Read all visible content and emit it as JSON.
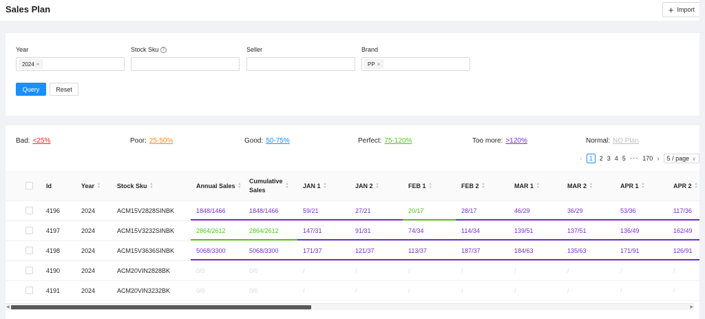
{
  "header": {
    "title": "Sales Plan",
    "import_label": "Import"
  },
  "filters": {
    "year": {
      "label": "Year",
      "tags": [
        "2024"
      ]
    },
    "stock_sku": {
      "label": "Stock Sku",
      "value": ""
    },
    "seller": {
      "label": "Seller",
      "value": ""
    },
    "brand": {
      "label": "Brand",
      "tags": [
        "PP"
      ]
    },
    "query_label": "Query",
    "reset_label": "Reset"
  },
  "legend": [
    {
      "label": "Bad:",
      "value": "<25%",
      "color": "#f5222d"
    },
    {
      "label": "Poor:",
      "value": "25-50%",
      "color": "#fa8c16"
    },
    {
      "label": "Good:",
      "value": "50-75%",
      "color": "#1890ff"
    },
    {
      "label": "Perfect:",
      "value": "75-120%",
      "color": "#52c41a"
    },
    {
      "label": "Too more:",
      "value": ">120%",
      "color": "#722ed1"
    },
    {
      "label": "Normal:",
      "value": "NO Plan",
      "color": "#bfbfbf"
    }
  ],
  "pagination": {
    "pages": [
      "1",
      "2",
      "3",
      "4",
      "5"
    ],
    "current": "1",
    "ellipsis": "•••",
    "last": "170",
    "page_size": "5 / page"
  },
  "table": {
    "columns": [
      "Id",
      "Year",
      "Stock Sku",
      "Annual Sales",
      "Cumulative Sales",
      "JAN 1",
      "JAN 2",
      "FEB 1",
      "FEB 2",
      "MAR 1",
      "MAR 2",
      "APR 1",
      "APR 2"
    ],
    "rows": [
      {
        "id": "4196",
        "year": "2024",
        "sku": "ACM15V2828SINBK",
        "cells": [
          "1848/1466",
          "1848/1466",
          "59/21",
          "27/21",
          "20/17",
          "28/17",
          "46/29",
          "36/29",
          "53/36",
          "117/36"
        ]
      },
      {
        "id": "4197",
        "year": "2024",
        "sku": "ACM15V3232SINBK",
        "cells": [
          "2864/2612",
          "2864/2612",
          "147/31",
          "91/31",
          "74/34",
          "114/34",
          "139/51",
          "137/51",
          "136/49",
          "162/49"
        ]
      },
      {
        "id": "4198",
        "year": "2024",
        "sku": "ACM15V3636SINBK",
        "cells": [
          "5068/3300",
          "5068/3300",
          "171/37",
          "121/37",
          "113/37",
          "187/37",
          "184/63",
          "135/63",
          "171/91",
          "126/91"
        ]
      },
      {
        "id": "4190",
        "year": "2024",
        "sku": "ACM20VIN2828BK",
        "cells": [
          "0/0",
          "0/0",
          "/",
          "/",
          "/",
          "/",
          "/",
          "/",
          "/",
          "/"
        ]
      },
      {
        "id": "4191",
        "year": "2024",
        "sku": "ACM20VIN3232BK",
        "cells": [
          "0/0",
          "0/0",
          "/",
          "/",
          "/",
          "/",
          "/",
          "/",
          "/",
          "/"
        ]
      }
    ],
    "cell_colors": [
      [
        "purple",
        "purple",
        "purple",
        "purple",
        "green",
        "purple",
        "purple",
        "purple",
        "purple",
        "purple"
      ],
      [
        "green",
        "green",
        "purple",
        "purple",
        "purple",
        "purple",
        "purple",
        "purple",
        "purple",
        "purple"
      ],
      [
        "purple",
        "purple",
        "purple",
        "purple",
        "purple",
        "purple",
        "purple",
        "purple",
        "purple",
        "purple"
      ],
      [
        "gray",
        "gray",
        "gray",
        "gray",
        "gray",
        "gray",
        "gray",
        "gray",
        "gray",
        "gray"
      ],
      [
        "gray",
        "gray",
        "gray",
        "gray",
        "gray",
        "gray",
        "gray",
        "gray",
        "gray",
        "gray"
      ]
    ]
  }
}
